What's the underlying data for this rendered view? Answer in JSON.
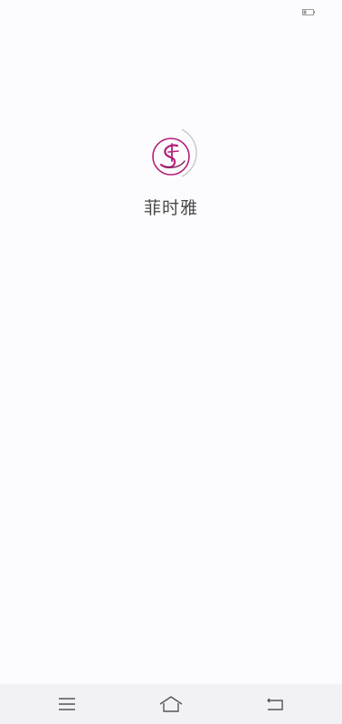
{
  "app": {
    "name": "菲时雅"
  },
  "theme": {
    "brand_color": "#b3207a",
    "arc_color": "#c8c8c8",
    "text_color": "#4a4a4a",
    "nav_icon_color": "#555555"
  },
  "status_bar": {
    "battery_icon": "battery-icon"
  },
  "nav_bar": {
    "menu_icon": "menu-icon",
    "home_icon": "home-icon",
    "back_icon": "back-icon"
  }
}
